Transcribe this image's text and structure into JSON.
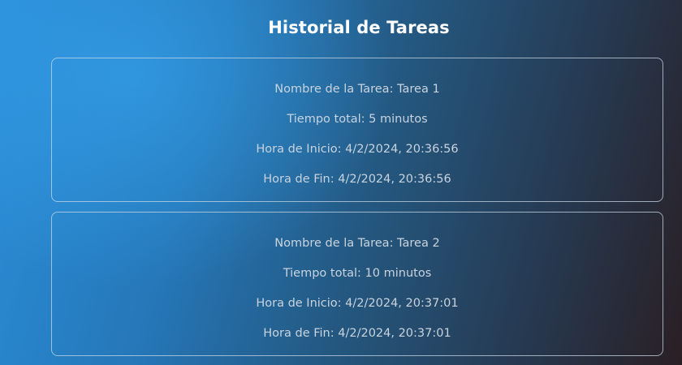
{
  "header": {
    "title": "Historial de Tareas"
  },
  "tasks": [
    {
      "name": "Nombre de la Tarea: Tarea 1",
      "total": "Tiempo total: 5 minutos",
      "start": "Hora de Inicio: 4/2/2024, 20:36:56",
      "end": "Hora de Fin: 4/2/2024, 20:36:56"
    },
    {
      "name": "Nombre de la Tarea: Tarea 2",
      "total": "Tiempo total: 10 minutos",
      "start": "Hora de Inicio: 4/2/2024, 20:37:01",
      "end": "Hora de Fin: 4/2/2024, 20:37:01"
    }
  ],
  "colors": {
    "title": "#ffffff",
    "text": "#c8d3de",
    "card_border": "#c8d7e6",
    "accent": "#2b8ed8"
  }
}
